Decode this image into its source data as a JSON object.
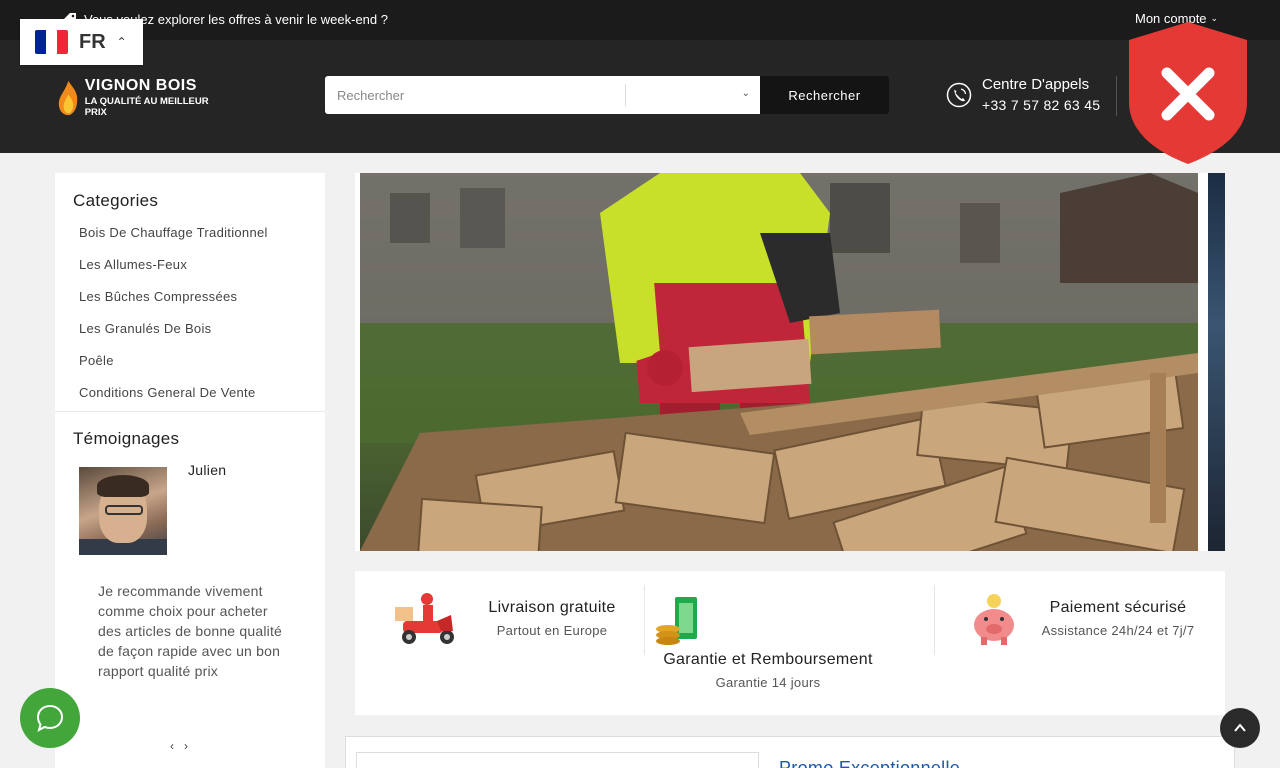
{
  "topbar": {
    "promo_text": "Vous voulez explorer les offres à venir le week-end ?",
    "account_label": "Mon compte"
  },
  "language": {
    "code": "FR",
    "flag_colors": [
      "#002395",
      "#ffffff",
      "#ed2939"
    ]
  },
  "logo": {
    "name": "VIGNON BOIS",
    "slogan": "LA QUALITÉ AU MEILLEUR PRIX"
  },
  "search": {
    "placeholder": "Rechercher",
    "category_value": "",
    "button_label": "Rechercher"
  },
  "callcenter": {
    "label": "Centre D'appels",
    "number": "+33 7 57 82 63 45"
  },
  "sidebar": {
    "categories_title": "Categories",
    "categories": [
      "Bois De Chauffage Traditionnel",
      "Les Allumes-Feux",
      "Les Bûches Compressées",
      "Les Granulés De Bois",
      "Poêle",
      "Conditions General De Vente"
    ],
    "testimonials_title": "Témoignages",
    "testimonial": {
      "author": "Julien",
      "quote": "Je recommande vivement comme choix pour acheter des articles de bonne qualité de façon rapide avec un bon rapport qualité prix"
    }
  },
  "features": [
    {
      "title": "Livraison gratuite",
      "subtitle": "Partout en Europe",
      "icon": "delivery-scooter-icon"
    },
    {
      "title": "Garantie et Remboursement",
      "subtitle": "Garantie 14 jours",
      "icon": "money-coins-icon"
    },
    {
      "title": "Paiement sécurisé",
      "subtitle": "Assistance 24h/24 et 7j/7",
      "icon": "piggy-bank-icon"
    }
  ],
  "promo_card": {
    "title": "Promo Exceptionnelle"
  },
  "colors": {
    "topbar": "#1b1b1b",
    "header": "#252525",
    "accent_red": "#e53935",
    "chat_green": "#43a63b",
    "link_blue": "#1f58a8"
  }
}
